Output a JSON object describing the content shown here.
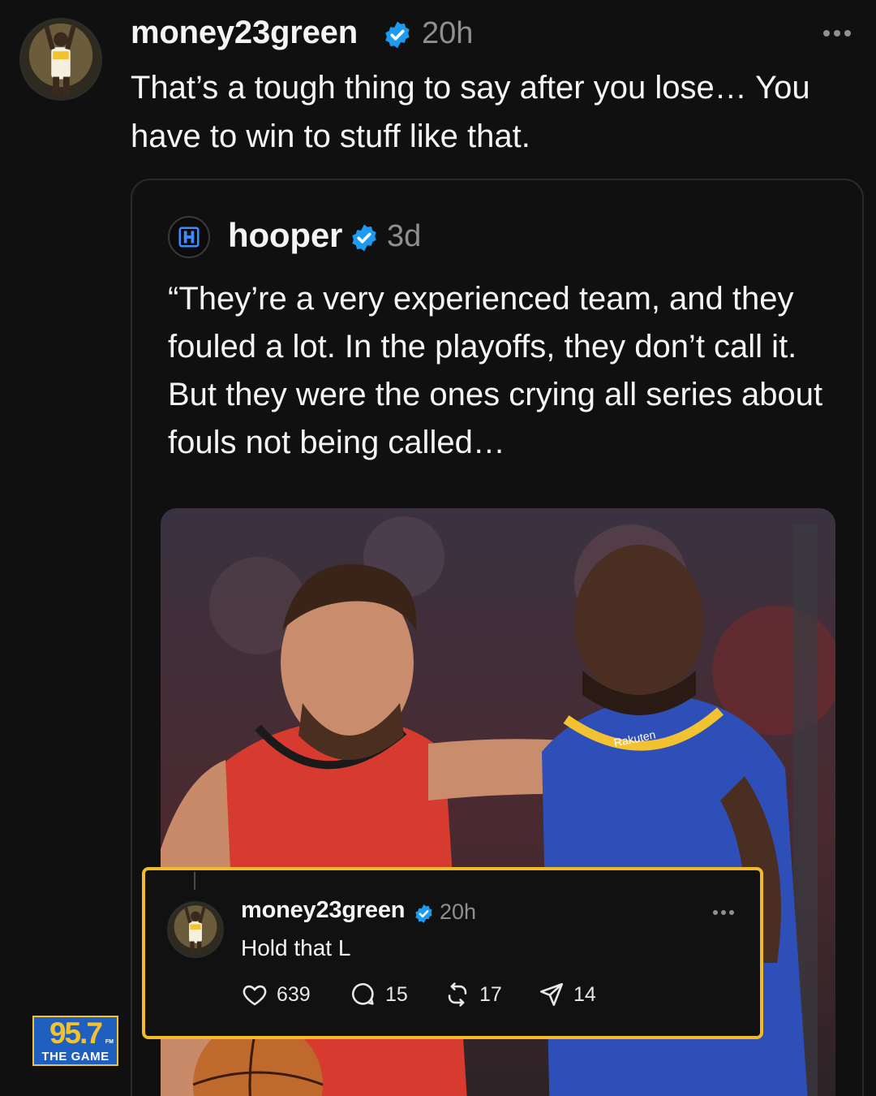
{
  "post": {
    "username": "money23green",
    "time": "20h",
    "text": "That’s a tough thing to say after you lose… You have to win to stuff like that."
  },
  "quoted_post": {
    "username": "hooper",
    "time": "3d",
    "text": "“They’re a very experienced team, and they fouled a lot. In the playoffs, they don’t call it. But they were the ones crying all series about fouls not being called…",
    "avatar_icon": "hooper-logo-icon",
    "photo_jersey_text": "Rakuten"
  },
  "reply": {
    "username": "money23green",
    "time": "20h",
    "text": "Hold that L",
    "likes": "639",
    "comments": "15",
    "reposts": "17",
    "shares": "14"
  },
  "overlay_logo": {
    "number": "95.7",
    "fm": "FM",
    "name": "THE GAME"
  },
  "colors": {
    "background": "#101010",
    "verified": "#1d9bf0",
    "highlight_border": "#f2b92b",
    "muted_text": "#8f8f8f"
  }
}
